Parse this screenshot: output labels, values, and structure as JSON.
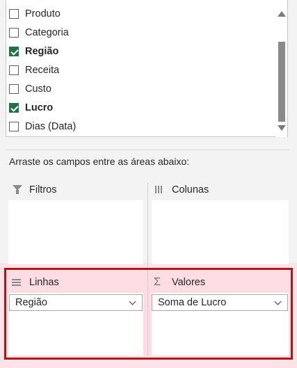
{
  "field_list": {
    "items": [
      {
        "label": "Produto",
        "checked": false
      },
      {
        "label": "Categoria",
        "checked": false
      },
      {
        "label": "Região",
        "checked": true
      },
      {
        "label": "Receita",
        "checked": false
      },
      {
        "label": "Custo",
        "checked": false
      },
      {
        "label": "Lucro",
        "checked": true
      },
      {
        "label": "Dias (Data)",
        "checked": false
      }
    ]
  },
  "instructions": "Arraste os campos entre as áreas abaixo:",
  "areas": {
    "filters": {
      "label": "Filtros",
      "icon": "filter-icon"
    },
    "columns": {
      "label": "Colunas",
      "icon": "columns-icon"
    },
    "rows": {
      "label": "Linhas",
      "icon": "rows-icon",
      "field": "Região"
    },
    "values": {
      "label": "Valores",
      "icon": "sigma-icon",
      "field": "Soma de Lucro"
    }
  },
  "colors": {
    "check": "#217346",
    "highlight_border": "#a61c1c",
    "highlight_bg": "#fde2e8"
  }
}
